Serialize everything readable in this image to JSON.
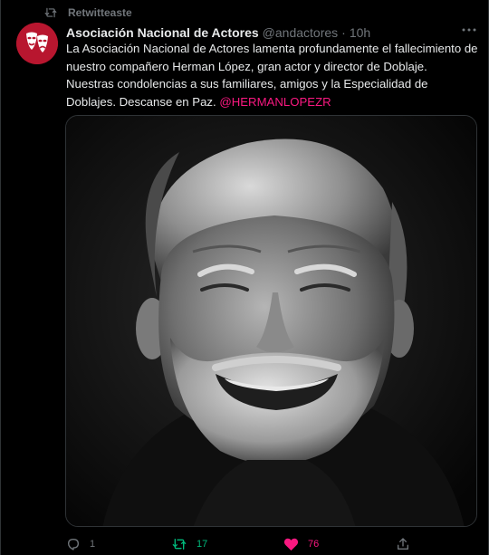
{
  "colors": {
    "background": "#000000",
    "text_primary": "#e7e9ea",
    "text_secondary": "#71767b",
    "mention": "#f91880",
    "retweet_active": "#00ba7c",
    "like_active": "#f91880",
    "avatar_bg": "#b8162f"
  },
  "social_context": {
    "icon": "retweet-icon",
    "label": "Retwitteaste"
  },
  "author": {
    "avatar_icon": "theatre-mask-logo",
    "name": "Asociación Nacional de Actores",
    "handle": "@andactores",
    "separator": "·",
    "time": "10h"
  },
  "more_menu": {
    "icon": "more-horizontal-icon",
    "label": "···"
  },
  "tweet": {
    "text": "La Asociación Nacional de Actores lamenta profundamente el fallecimiento de nuestro compañero Herman López, gran actor y director de Doblaje. Nuestras condolencias a sus familiares, amigos y la Especialidad de Doblajes. Descanse en Paz. ",
    "mention": "@HERMANLOPEZR"
  },
  "media": {
    "kind": "black-and-white portrait photo"
  },
  "actions": {
    "reply": {
      "icon": "reply-icon",
      "count": "1"
    },
    "retweet": {
      "icon": "retweet-icon",
      "count": "17",
      "active": true
    },
    "like": {
      "icon": "heart-filled-icon",
      "count": "76",
      "active": true
    },
    "share": {
      "icon": "share-icon"
    }
  }
}
